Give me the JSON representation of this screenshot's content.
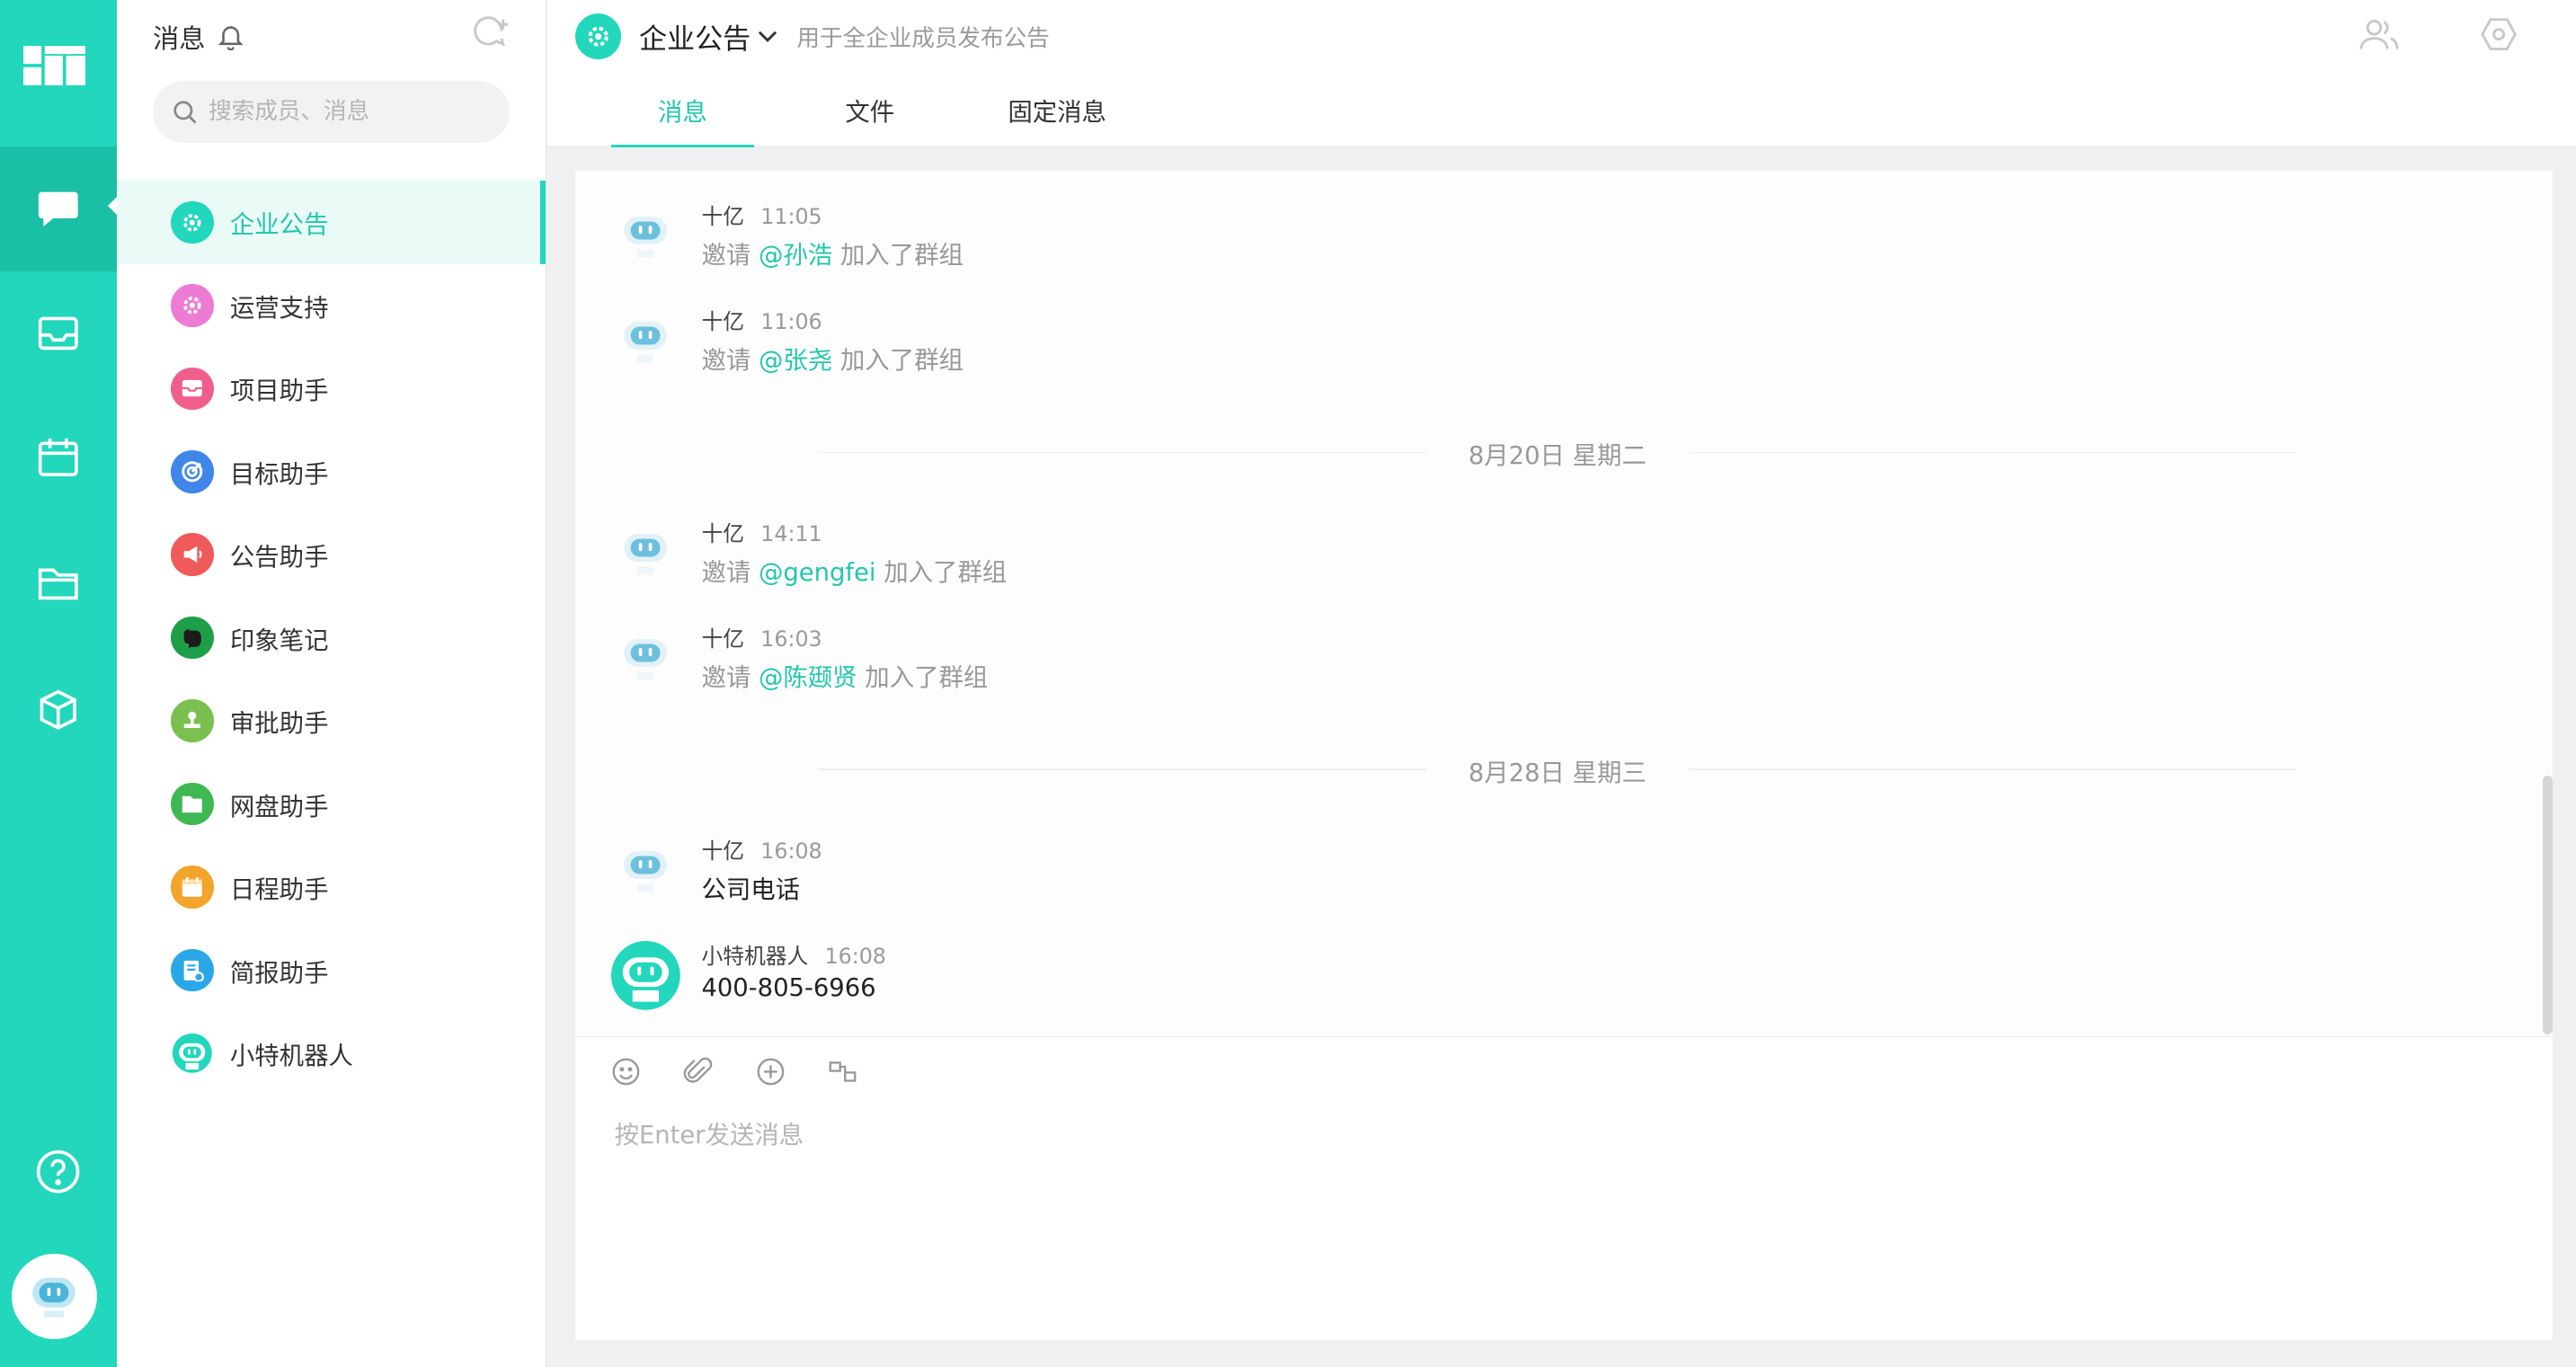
{
  "list": {
    "title": "消息",
    "search_placeholder": "搜索成员、消息",
    "channels": [
      {
        "label": "企业公告",
        "color": "#22d7bb",
        "icon": "gear-icon",
        "active": true
      },
      {
        "label": "运营支持",
        "color": "#ee7bd3",
        "icon": "gear-icon"
      },
      {
        "label": "项目助手",
        "color": "#f05f8c",
        "icon": "inbox-icon"
      },
      {
        "label": "目标助手",
        "color": "#3f86e8",
        "icon": "target-icon"
      },
      {
        "label": "公告助手",
        "color": "#f15a5a",
        "icon": "megaphone-icon"
      },
      {
        "label": "印象笔记",
        "color": "#1f9e4a",
        "icon": "elephant-icon"
      },
      {
        "label": "审批助手",
        "color": "#7ac04f",
        "icon": "stamp-icon"
      },
      {
        "label": "网盘助手",
        "color": "#3fb854",
        "icon": "folder-icon"
      },
      {
        "label": "日程助手",
        "color": "#f3a42b",
        "icon": "calendar-icon"
      },
      {
        "label": "简报助手",
        "color": "#2aa7e6",
        "icon": "report-icon"
      },
      {
        "label": "小特机器人",
        "color": "#ffffff",
        "icon": "robot-icon"
      }
    ]
  },
  "header": {
    "channel_name": "企业公告",
    "channel_desc": "用于全企业成员发布公告",
    "tabs": [
      "消息",
      "文件",
      "固定消息"
    ]
  },
  "messages": [
    {
      "sender": "十亿",
      "time": "11:05",
      "prefix": "邀请 ",
      "mention": "@孙浩",
      "suffix": " 加入了群组"
    },
    {
      "sender": "十亿",
      "time": "11:06",
      "prefix": "邀请 ",
      "mention": "@张尧",
      "suffix": " 加入了群组"
    },
    {
      "divider": "8月20日  星期二"
    },
    {
      "sender": "十亿",
      "time": "14:11",
      "prefix": "邀请 ",
      "mention": "@gengfei",
      "suffix": " 加入了群组"
    },
    {
      "sender": "十亿",
      "time": "16:03",
      "prefix": "邀请 ",
      "mention": "@陈颋贤",
      "suffix": " 加入了群组"
    },
    {
      "divider": "8月28日  星期三"
    },
    {
      "sender": "十亿",
      "time": "16:08",
      "text": "公司电话"
    },
    {
      "sender": "小特机器人",
      "time": "16:08",
      "text": "400-805-6966"
    }
  ],
  "composer": {
    "placeholder": "按Enter发送消息"
  },
  "colors": {
    "accent": "#22d7bb",
    "rail_active": "#1bbfa6"
  }
}
